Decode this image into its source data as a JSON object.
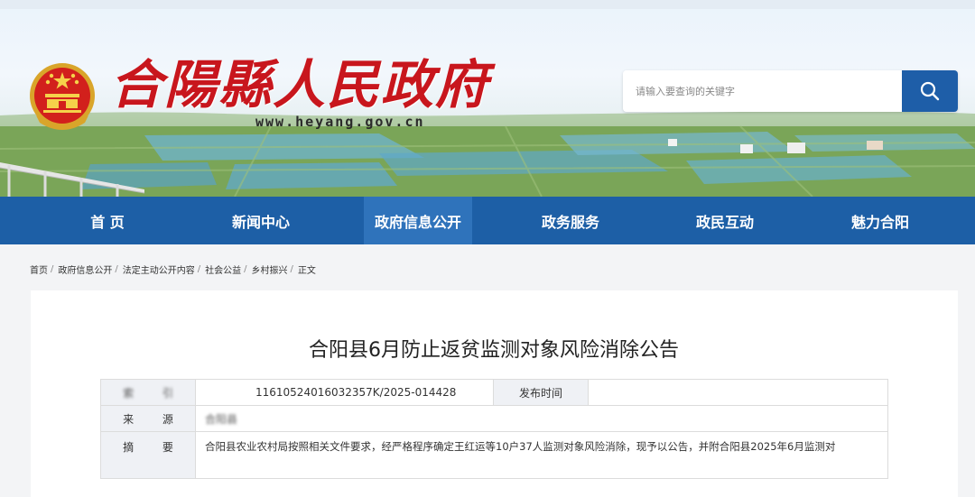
{
  "site": {
    "title": "合陽縣人民政府",
    "url": "www.heyang.gov.cn"
  },
  "search": {
    "placeholder": "请输入要查询的关键字",
    "button_icon": "search-icon"
  },
  "nav": {
    "items": [
      {
        "label": "首 页"
      },
      {
        "label": "新闻中心"
      },
      {
        "label": "政府信息公开"
      },
      {
        "label": "政务服务"
      },
      {
        "label": "政民互动"
      },
      {
        "label": "魅力合阳"
      }
    ],
    "active_index": 2
  },
  "breadcrumb": {
    "items": [
      "首页",
      "政府信息公开",
      "法定主动公开内容",
      "社会公益",
      "乡村振兴",
      "正文"
    ],
    "separator": "/"
  },
  "article": {
    "title": "合阳县6月防止返贫监测对象风险消除公告",
    "meta": {
      "index_label": "索 引",
      "index_value": "11610524016032357K/2025-014428",
      "publish_label": "发布时间",
      "publish_value": "",
      "source_label": "来 源",
      "source_value": "合阳县",
      "summary_label": "摘 要",
      "summary_value": "合阳县农业农村局按照相关文件要求，经严格程序确定王红运等10户37人监测对象风险消除，现予以公告，并附合阳县2025年6月监测对"
    }
  },
  "colors": {
    "nav_bg": "#1d5fa6",
    "nav_active": "#2f73bb",
    "title_red": "#c8161d",
    "search_button": "#1e5ea8"
  }
}
